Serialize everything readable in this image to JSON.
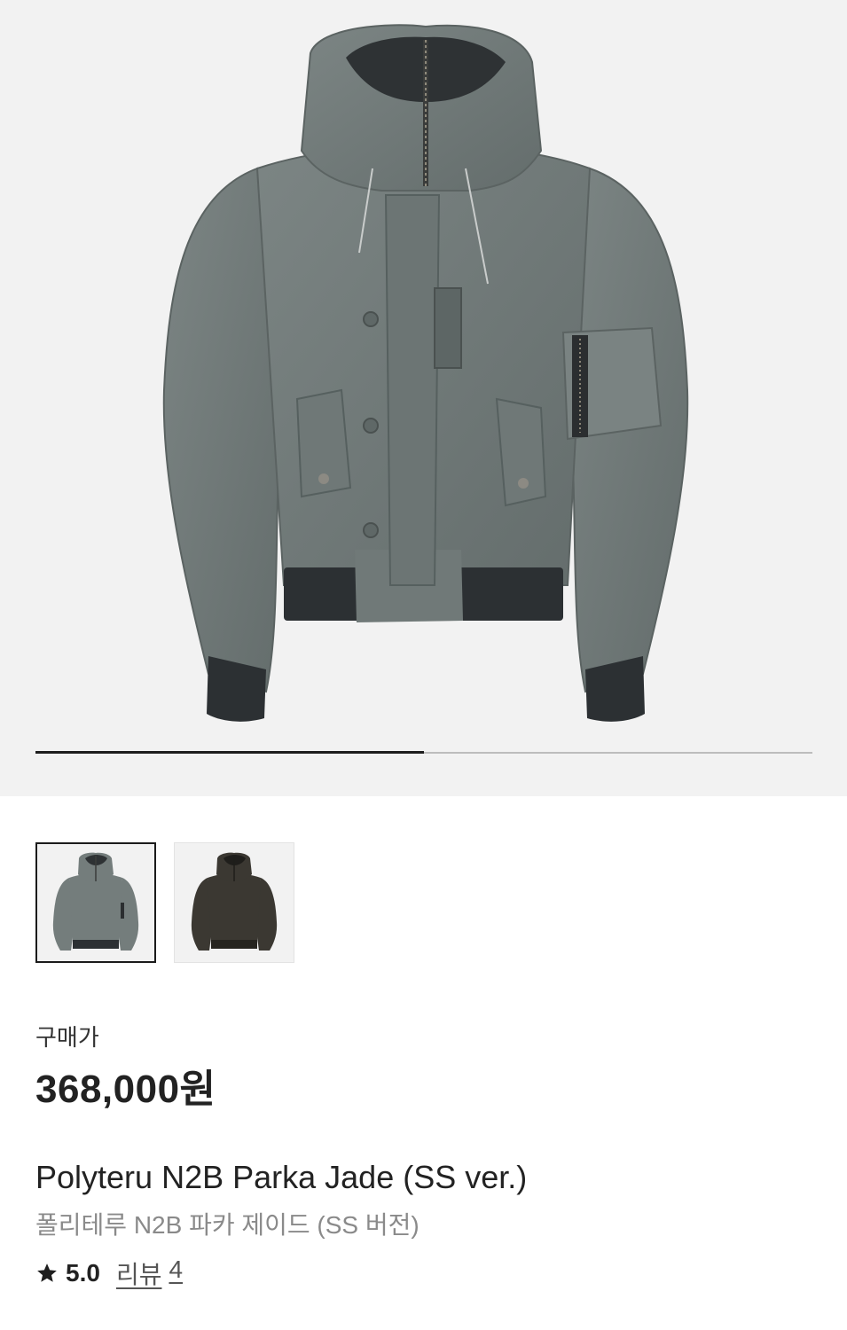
{
  "gallery": {
    "main_image_icon": "jacket-image",
    "progress": 0.5,
    "thumbnails": [
      {
        "icon": "jacket-jade-thumbnail",
        "color": "#6f7877",
        "selected": true
      },
      {
        "icon": "jacket-brown-thumbnail",
        "color": "#3a3730",
        "selected": false
      }
    ]
  },
  "price": {
    "label": "구매가",
    "value": "368,000원"
  },
  "product": {
    "name_en": "Polyteru N2B Parka Jade (SS ver.)",
    "name_ko": "폴리테루 N2B 파카 제이드 (SS 버전)"
  },
  "rating": {
    "score": "5.0",
    "review_label": "리뷰",
    "review_count": "4"
  },
  "colors": {
    "jacket_main": "#727b7a",
    "rib": "#2c3033",
    "accent_dark": "#1e1e1e"
  }
}
